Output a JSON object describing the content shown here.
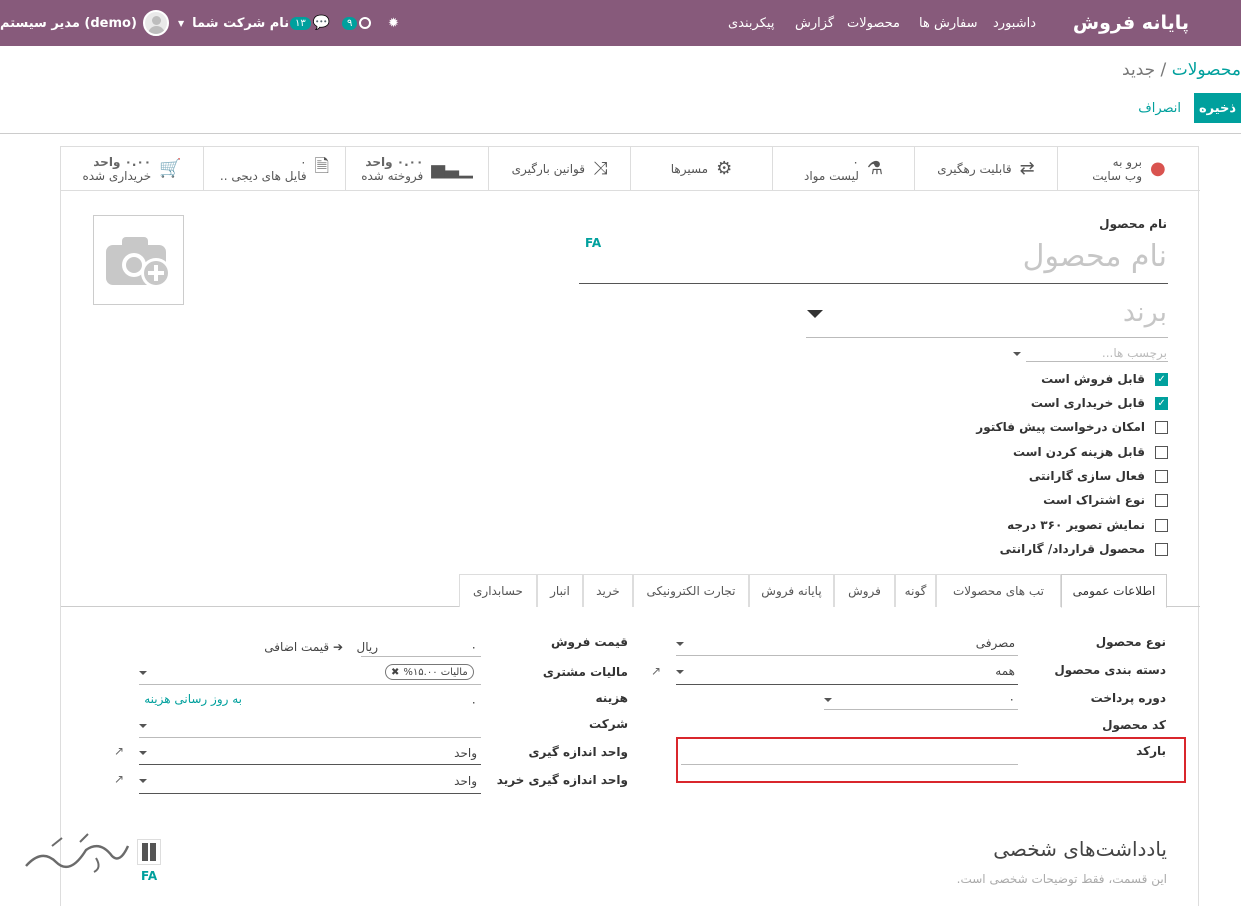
{
  "topbar": {
    "app_name": "پایانه فروش",
    "menu": [
      "داشبورد",
      "سفارش ها",
      "محصولات",
      "گزارش",
      "پیکربندی"
    ],
    "activity_count": "۹",
    "messages_count": "۱۳",
    "company": "نام شرکت شما",
    "user": "مدیر سیستم (demo)",
    "accent_color": "#875a7b"
  },
  "breadcrumb": {
    "parent": "محصولات",
    "sep": "/",
    "current": "جدید"
  },
  "buttons": {
    "save": "ذخیره",
    "discard": "انصراف"
  },
  "smart_buttons": [
    {
      "line1": "برو به",
      "line2": "وب سایت",
      "icon": "globe-icon"
    },
    {
      "line1": "قابلیت رهگیری",
      "line2": "",
      "icon": "exchange-icon"
    },
    {
      "line1": "۰",
      "line2": "لیست مواد",
      "icon": "flask-icon"
    },
    {
      "line1": "مسیرها",
      "line2": "",
      "icon": "cogs-icon"
    },
    {
      "line1": "قوانین بارگیری",
      "line2": "",
      "icon": "random-icon"
    },
    {
      "line1": "۰.۰۰ واحد",
      "line2": "فروخته شده",
      "icon": "bar-chart-icon"
    },
    {
      "line1": "۰",
      "line2": "فایل های دیجی ..",
      "icon": "file-icon"
    },
    {
      "line1": "۰.۰۰ واحد",
      "line2": "خریداری شده",
      "icon": "cart-icon"
    }
  ],
  "form": {
    "name_label": "نام محصول",
    "name_placeholder": "نام محصول",
    "lang": "FA",
    "brand_placeholder": "برند",
    "tags_placeholder": "برچسب ها...",
    "checkboxes": [
      {
        "label": "قابل فروش است",
        "checked": true
      },
      {
        "label": "قابل خریداری است",
        "checked": true
      },
      {
        "label": "امکان درخواست پیش فاکتور",
        "checked": false
      },
      {
        "label": "قابل هزینه کردن است",
        "checked": false
      },
      {
        "label": "فعال سازی گارانتی",
        "checked": false
      },
      {
        "label": "نوع اشتراک است",
        "checked": false
      },
      {
        "label": "نمایش تصویر ۳۶۰ درجه",
        "checked": false
      },
      {
        "label": "محصول قرارداد/ گارانتی",
        "checked": false
      }
    ]
  },
  "tabs": [
    "اطلاعات عمومی",
    "تب های محصولات",
    "گونه",
    "فروش",
    "پایانه فروش",
    "تجارت الکترونیکی",
    "خرید",
    "انبار",
    "حسابداری"
  ],
  "general": {
    "product_type_label": "نوع محصول",
    "product_type": "مصرفی",
    "category_label": "دسته بندی محصول",
    "category": "همه",
    "payment_period_label": "دوره پرداخت",
    "payment_period": "۰",
    "code_label": "کد محصول",
    "barcode_label": "بارکد",
    "sale_price_label": "قیمت فروش",
    "sale_price": "۰",
    "currency": "ریال",
    "extra_price": "قیمت اضافی",
    "taxes_label": "مالیات مشتری",
    "tax_tag": "مالیات ۱۵.۰۰%",
    "cost_label": "هزینه",
    "cost": "۰",
    "update_cost": "به روز رسانی هزینه",
    "company_label": "شرکت",
    "uom_label": "واحد اندازه گیری",
    "uom": "واحد",
    "uom_po_label": "واحد اندازه گیری خرید",
    "uom_po": "واحد"
  },
  "notes": {
    "title": "یادداشت‌های شخصی",
    "placeholder": "این قسمت، فقط توضیحات شخصی است."
  },
  "watermark": {
    "lang": "FA"
  }
}
